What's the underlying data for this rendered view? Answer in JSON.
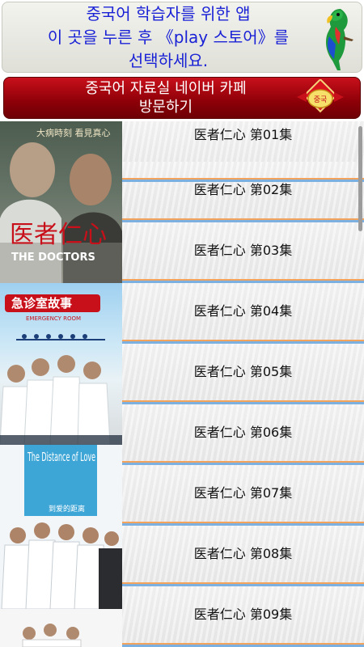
{
  "promo": {
    "line1": "중국어 학습자를 위한 앱",
    "line2": "이 곳을 누른 후 《play 스토어》를",
    "line3": "선택하세요."
  },
  "cafe": {
    "line1": "중국어 자료실 네이버 카페",
    "line2": "방문하기",
    "emblem_text": "중국"
  },
  "posters": [
    {
      "title": "医者仁心",
      "subtitle": "THE DOCTORS",
      "tagline": "大病時刻 看見真心"
    },
    {
      "title": "急诊室故事",
      "subtitle": "EMERGENCY ROOM"
    },
    {
      "title": "The Distance of Love",
      "subtitle": "到爱的距离"
    },
    {
      "title": ""
    }
  ],
  "episodes": [
    {
      "label": "医者仁心 第01集"
    },
    {
      "label": "医者仁心 第02集"
    },
    {
      "label": "医者仁心 第03集"
    },
    {
      "label": "医者仁心 第04集"
    },
    {
      "label": "医者仁心 第05集"
    },
    {
      "label": "医者仁心 第06集"
    },
    {
      "label": "医者仁心 第07集"
    },
    {
      "label": "医者仁心 第08集"
    },
    {
      "label": "医者仁心 第09集"
    }
  ],
  "colors": {
    "promo_text": "#1a22d6",
    "cafe_bg": "#8d0008",
    "divider_orange": "#f3a35b",
    "divider_blue": "#7cb0e0"
  }
}
